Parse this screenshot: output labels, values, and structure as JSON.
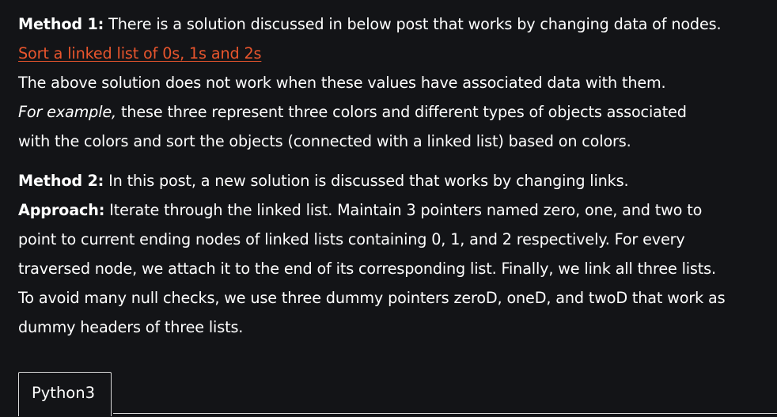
{
  "article": {
    "method1": {
      "label": "Method 1:",
      "text": " There is a solution discussed in below post that works by changing data of nodes."
    },
    "link": "Sort a linked list of 0s, 1s and 2s",
    "line_above": "The above solution does not work when these values have associated data with them.",
    "example": {
      "italic": "For example,",
      "text": " these three represent three colors and different types of objects associated"
    },
    "example_line2": "with the colors and sort the objects (connected with a linked list) based on colors.",
    "method2": {
      "label": "Method 2:",
      "text": " In this post, a new solution is discussed that works by changing links."
    },
    "approach": {
      "label": "Approach:",
      "text": " Iterate through the linked list. Maintain 3 pointers named zero, one, and two to"
    },
    "approach_lines": [
      "point to current ending nodes of linked lists containing 0, 1, and 2 respectively. For every",
      "traversed node, we attach it to the end of its corresponding list. Finally, we link all three lists.",
      "To avoid many null checks, we use three dummy pointers zeroD, oneD, and twoD that work as",
      "dummy headers of three lists."
    ]
  },
  "tabs": [
    {
      "label": "Python3"
    }
  ]
}
